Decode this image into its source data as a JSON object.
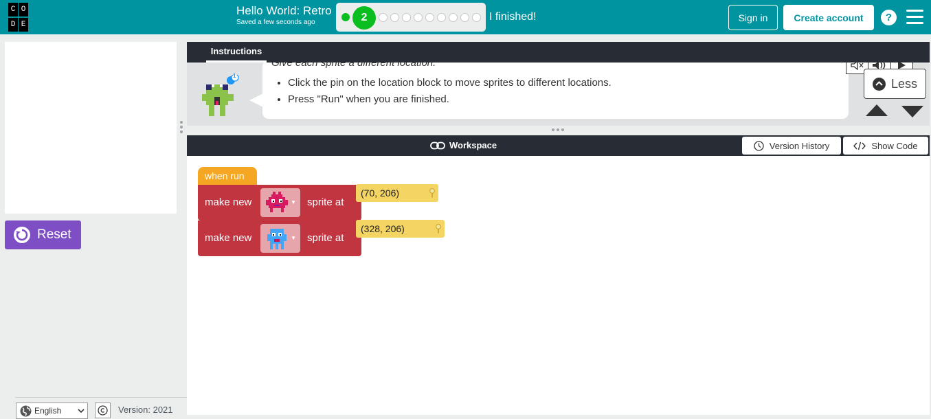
{
  "header": {
    "logo_letters": [
      "C",
      "O",
      "",
      "D",
      "E",
      ""
    ],
    "title": "Hello World: Retro",
    "saved_status": "Saved a few seconds ago",
    "current_level": "2",
    "level_count": 10,
    "finished_label": "I finished!",
    "sign_in_label": "Sign in",
    "create_account_label": "Create account",
    "help_label": "?"
  },
  "left_panel": {
    "reset_label": "Reset",
    "language": "English",
    "version": "Version: 2021"
  },
  "instructions": {
    "tab_label": "Instructions",
    "bot_badge": "1",
    "lead": "Give each sprite a different location.",
    "bullets": [
      "Click the pin on the location block to move sprites to different locations.",
      "Press \"Run\" when you are finished."
    ],
    "less_label": "Less"
  },
  "workspace": {
    "title": "Workspace",
    "version_history_label": "Version History",
    "show_code_label": "Show Code",
    "blocks": {
      "event": "when run",
      "rows": [
        {
          "label_before": "make new",
          "sprite": "pink-alien-sprite",
          "label_after": "sprite at",
          "location": "(70, 206)"
        },
        {
          "label_before": "make new",
          "sprite": "blue-alien-sprite",
          "label_after": "sprite at",
          "location": "(328, 206)"
        }
      ]
    }
  },
  "colors": {
    "header_bg": "#0094a0",
    "progress_green": "#0bbe1f",
    "reset_purple": "#7e4fc4",
    "dark_bar": "#282c34",
    "event_block": "#f5a623",
    "sprite_block": "#c03540",
    "location_block": "#f4d463"
  }
}
